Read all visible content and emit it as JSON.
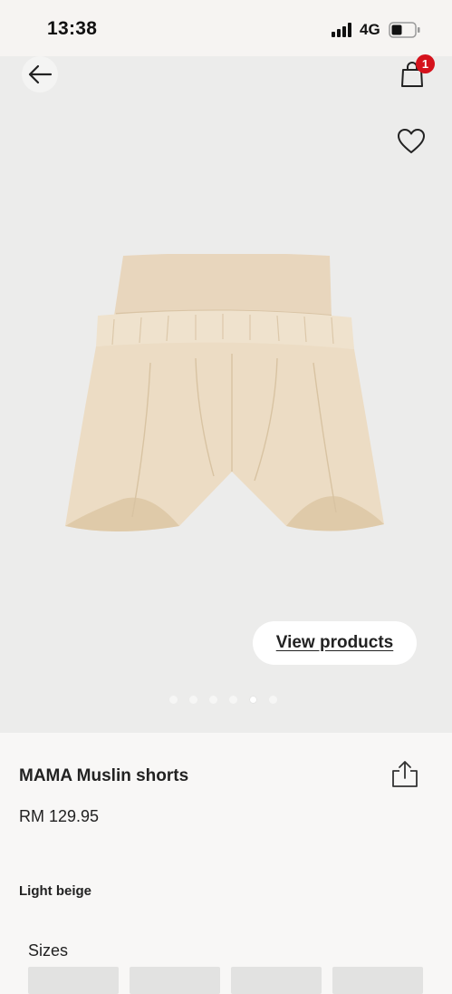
{
  "status_bar": {
    "time": "13:38",
    "network": "4G",
    "icons": [
      "signal-bars-icon",
      "battery-icon"
    ]
  },
  "header": {
    "back_icon": "arrow-left-icon",
    "cart_icon": "shopping-bag-icon",
    "cart_count": "1",
    "favorite_icon": "heart-outline-icon"
  },
  "gallery": {
    "view_products_label": "View products",
    "page_count": 6,
    "active_index": 4
  },
  "product": {
    "name": "MAMA Muslin shorts",
    "price": "RM 129.95",
    "color": "Light beige",
    "share_icon": "share-icon",
    "sizes_label": "Sizes"
  },
  "colors": {
    "badge": "#d5121c",
    "gallery_bg": "#ececeb",
    "fabric": "#ecdcc4"
  }
}
